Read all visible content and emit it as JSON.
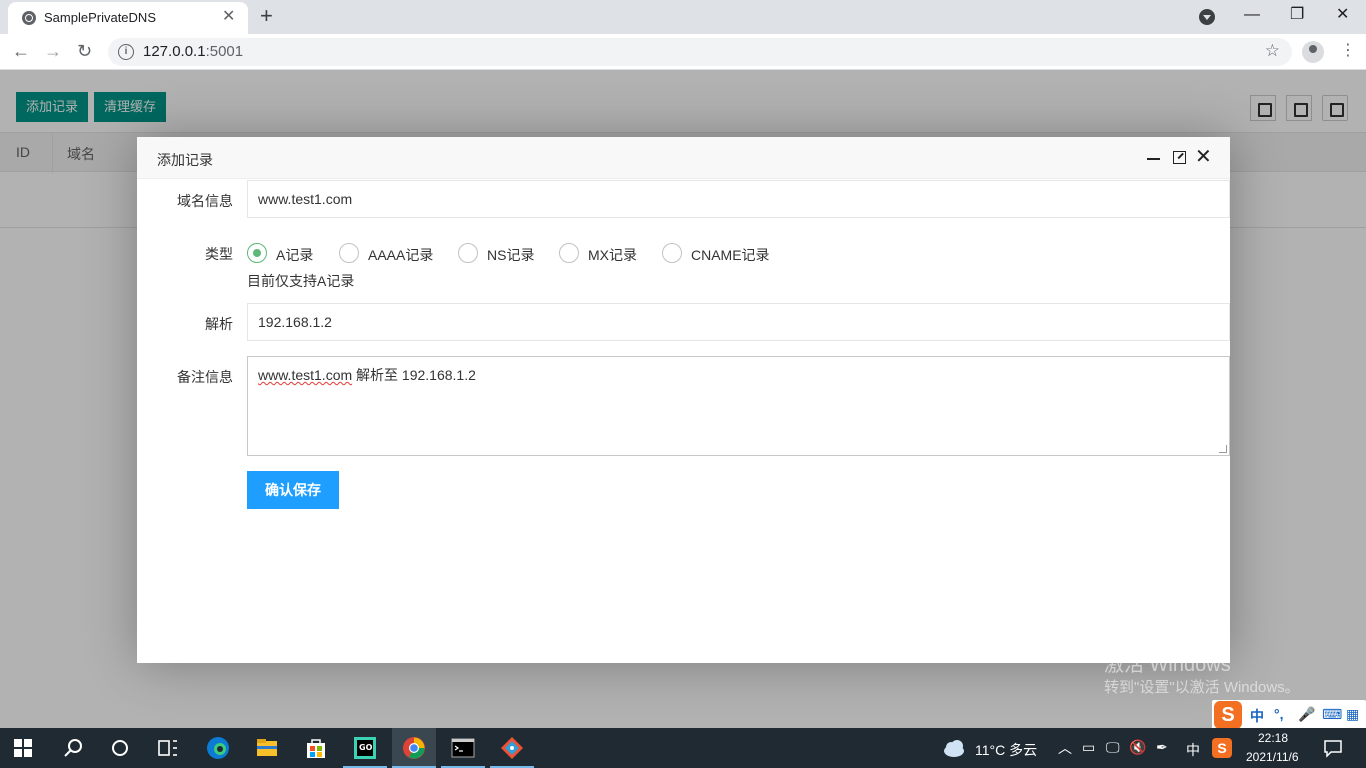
{
  "browser": {
    "tab_title": "SamplePrivateDNS",
    "tab_close": "✕",
    "new_tab": "+",
    "url_host": "127.0.0.1",
    "url_port": ":5001",
    "win_minimize": "—",
    "win_restore": "❐",
    "win_close": "✕"
  },
  "toolbar": {
    "add_label": "添加记录",
    "clear_label": "清理缓存"
  },
  "table": {
    "columns": [
      "ID",
      "域名"
    ]
  },
  "dialog": {
    "title": "添加记录",
    "close": "✕",
    "domain_label": "域名信息",
    "domain_value": "www.test1.com",
    "type_label": "类型",
    "types": [
      {
        "label": "A记录",
        "checked": true
      },
      {
        "label": "AAAA记录",
        "checked": false
      },
      {
        "label": "NS记录",
        "checked": false
      },
      {
        "label": "MX记录",
        "checked": false
      },
      {
        "label": "CNAME记录",
        "checked": false
      }
    ],
    "type_hint": "目前仅支持A记录",
    "resolve_label": "解析",
    "resolve_value": "192.168.1.2",
    "remark_label": "备注信息",
    "remark_link": "www.test1.com",
    "remark_rest": " 解析至 192.168.1.2",
    "save_label": "确认保存"
  },
  "watermark": {
    "line1": "激活 Windows",
    "line2": "转到\"设置\"以激活 Windows。"
  },
  "ime": {
    "logo": "S",
    "mode": "中",
    "punct": "°,",
    "mic": "🎤",
    "kbd": "⌨",
    "grid": "▦"
  },
  "taskbar": {
    "weather": "11°C 多云",
    "lang": "中",
    "time": "22:18",
    "date": "2021/11/6"
  },
  "colors": {
    "green": "#009688",
    "blue": "#1e9fff",
    "radio": "#5fb878"
  }
}
